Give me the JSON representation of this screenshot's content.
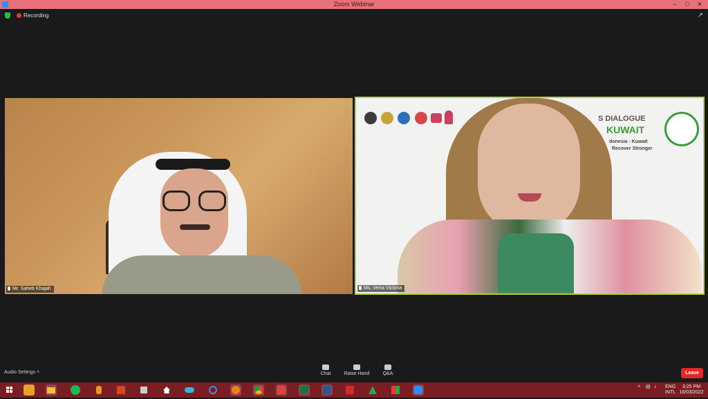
{
  "window": {
    "title": "Zoom Webinar"
  },
  "status": {
    "recording_label": "Recording"
  },
  "participants": [
    {
      "name": "Mr. Saheb Khajah"
    },
    {
      "name": "Ms. Verra Victoria"
    }
  ],
  "banner": {
    "line1": "S DIALOGUE",
    "line2": "KUWAIT",
    "line3": "donesia - Kuwait",
    "line4": "Recover Stronger"
  },
  "controls": {
    "audio_settings": "Audio Settings",
    "chat": "Chat",
    "raise_hand": "Raise Hand",
    "qa": "Q&A",
    "leave": "Leave"
  },
  "tray": {
    "lang1": "ENG",
    "lang2": "INTL",
    "time": "3:25 PM",
    "date": "16/03/2022"
  },
  "colors": {
    "active_speaker_border": "#b4d23a",
    "leave_button": "#e02828",
    "taskbar": "#7a1e24"
  }
}
